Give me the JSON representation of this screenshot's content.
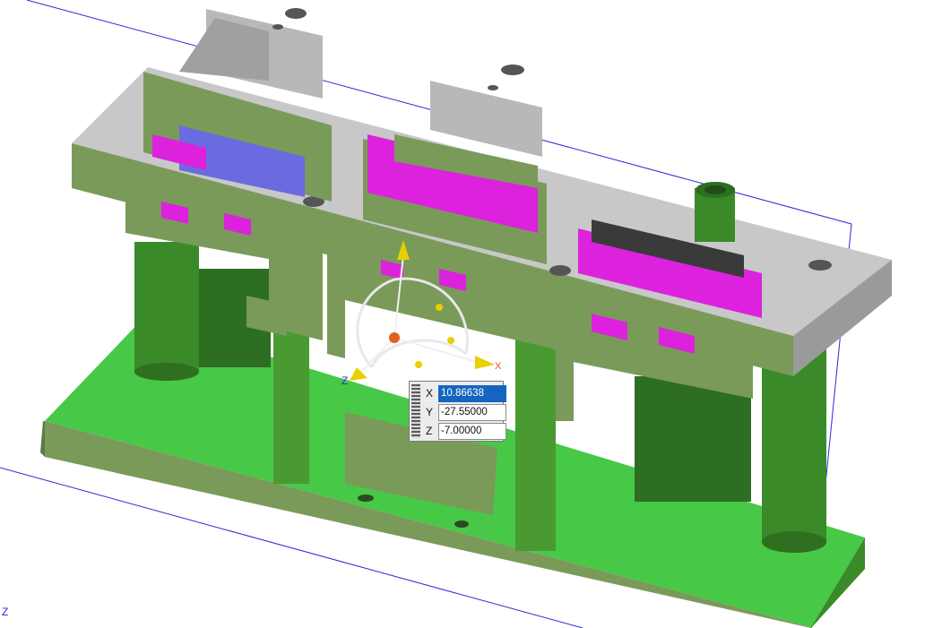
{
  "viewport": {
    "background": "#ffffff",
    "colors": {
      "base_green": "#47c847",
      "body_olive": "#7a9a5a",
      "pillar_green": "#3a8a2a",
      "plate_gray": "#c8c8c8",
      "magenta": "#dd22dd",
      "blue_face": "#6b6be0",
      "datum_line": "#2a2ad8"
    }
  },
  "manipulator": {
    "icons": [
      "y-axis-handle-icon",
      "x-axis-handle-icon",
      "z-axis-handle-icon",
      "origin-ball-icon"
    ],
    "axis_labels": {
      "z": "Z",
      "x": "X"
    }
  },
  "coordinate_panel": {
    "x_label": "X",
    "x_value": "10.86638",
    "y_label": "Y",
    "y_value": "-27.55000",
    "z_label": "Z",
    "z_value": "-7.00000"
  },
  "corner_triad": {
    "z_label": "Z"
  }
}
